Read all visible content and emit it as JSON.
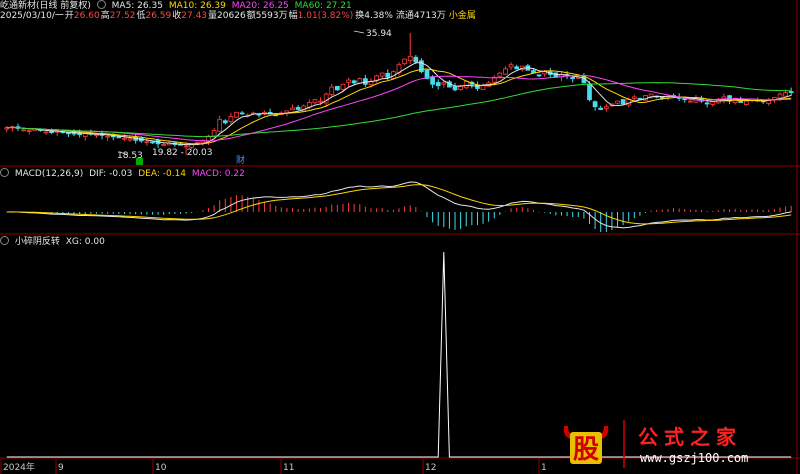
{
  "header": {
    "stock_name": "屹通新材(日线 前复权)",
    "ma": [
      {
        "label": "MA5: 26.35",
        "color": "#e6e6e6"
      },
      {
        "label": "MA10: 26.39",
        "color": "#ffd700"
      },
      {
        "label": "MA20: 26.25",
        "color": "#ff44ff"
      },
      {
        "label": "MA60: 27.21",
        "color": "#33dd33"
      }
    ]
  },
  "quote": {
    "date": "2025/03/10/一",
    "open_label": "开",
    "open": "26.60",
    "high_label": "高",
    "high": "27.52",
    "low_label": "低",
    "low": "26.59",
    "close_label": "收",
    "close": "27.43",
    "volume_label": "量",
    "volume": "20626",
    "amount_label": "额",
    "amount": "5593万",
    "change_label": "幅",
    "change": "1.01(3.82%)",
    "turnover": "换4.38%",
    "float": "流通4713万",
    "tag": "小金属"
  },
  "macd_header": {
    "title": "MACD(12,26,9)",
    "dif": "DIF: -0.03",
    "dea": "DEA: -0.14",
    "macd": "MACD: 0.22"
  },
  "ind_header": {
    "title": "小碎阴反转",
    "xg": "XG: 0.00"
  },
  "annotations": {
    "high_mark": "35.94",
    "low_mark": "18.53",
    "range_text": "19.82 - 20.03",
    "cai": "财"
  },
  "x_axis": {
    "labels": [
      "2024年",
      "9",
      "10",
      "11",
      "12",
      "1"
    ]
  },
  "logo": {
    "char": "股",
    "text": "公式之家",
    "url": "www.gszj100.com"
  },
  "chart_data": [
    {
      "type": "candlestick",
      "title": "屹通新材(日线 前复权)",
      "price_range": [
        17.5,
        37.5
      ],
      "ma": {
        "MA5": 26.35,
        "MA10": 26.39,
        "MA20": 26.25,
        "MA60": 27.21
      },
      "closes": [
        22.4,
        22.5,
        22.3,
        22.1,
        22.0,
        22.2,
        22.0,
        21.8,
        21.7,
        21.9,
        21.8,
        21.6,
        21.5,
        21.4,
        21.6,
        21.5,
        21.4,
        21.3,
        21.2,
        21.1,
        21.0,
        20.9,
        20.8,
        20.6,
        20.5,
        20.4,
        20.3,
        20.1,
        20.0,
        20.2,
        20.0,
        19.9,
        19.8,
        20.0,
        20.3,
        20.6,
        21.2,
        22.0,
        23.6,
        23.1,
        24.0,
        24.6,
        24.4,
        24.2,
        24.5,
        24.3,
        24.6,
        24.4,
        24.2,
        24.5,
        24.8,
        25.2,
        25.0,
        25.5,
        26.0,
        26.4,
        26.2,
        27.2,
        28.2,
        27.8,
        28.6,
        29.2,
        28.8,
        29.4,
        28.6,
        29.0,
        29.8,
        30.2,
        29.6,
        30.4,
        31.4,
        32.2,
        32.6,
        31.8,
        30.4,
        29.4,
        28.6,
        28.4,
        28.8,
        28.2,
        27.8,
        28.4,
        29.0,
        28.6,
        28.0,
        28.4,
        28.8,
        29.6,
        30.2,
        30.8,
        31.4,
        30.8,
        31.2,
        30.6,
        30.2,
        29.8,
        30.4,
        30.0,
        29.6,
        30.0,
        29.8,
        29.4,
        29.6,
        28.8,
        26.4,
        25.4,
        25.0,
        25.4,
        25.8,
        26.2,
        25.8,
        26.4,
        26.8,
        26.6,
        27.0,
        27.2,
        26.8,
        26.6,
        26.8,
        27.0,
        26.6,
        26.4,
        26.2,
        26.6,
        26.2,
        25.8,
        26.1,
        26.4,
        26.8,
        26.2,
        26.6,
        26.0,
        26.2,
        26.5,
        26.3,
        26.1,
        26.4,
        26.7,
        27.2,
        27.4,
        27.43
      ],
      "extremes": {
        "high": 35.94,
        "low": 18.53
      }
    },
    {
      "type": "line",
      "title": "MACD(12,26,9)",
      "series": [
        {
          "name": "DIF",
          "color": "#e6e6e6"
        },
        {
          "name": "DEA",
          "color": "#ffd700"
        },
        {
          "name": "MACD",
          "color": "#ff44ff"
        }
      ],
      "current": {
        "DIF": -0.03,
        "DEA": -0.14,
        "MACD": 0.22
      }
    },
    {
      "type": "line",
      "title": "小碎阴反转",
      "series": [
        {
          "name": "XG",
          "color": "#ffffff"
        }
      ],
      "signal_bar_index": 78,
      "current": {
        "XG": 0.0
      }
    }
  ]
}
